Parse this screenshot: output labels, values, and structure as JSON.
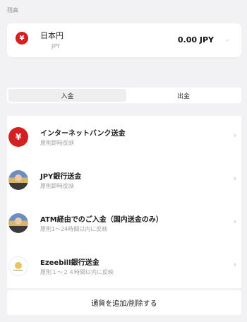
{
  "balance": {
    "caption": "残高",
    "currency_name": "日本円",
    "currency_code": "JPY",
    "amount": "0.00 JPY",
    "yen_symbol": "¥"
  },
  "tabs": {
    "deposit": "入金",
    "withdraw": "出金",
    "selected": "deposit"
  },
  "methods": [
    {
      "title": "インターネットバンク送金",
      "subtitle": "原則即時反映",
      "icon": "yen-icon"
    },
    {
      "title": "JPY銀行送金",
      "subtitle": "原則即時反映",
      "icon": "bank-avatar-icon"
    },
    {
      "title": "ATM経由でのご入金（国内送金のみ）",
      "subtitle": "原則1〜24時間以内に反映",
      "icon": "atm-avatar-icon"
    },
    {
      "title": "Ezeebill銀行送金",
      "subtitle": "原則１〜２４時間以内に反映",
      "icon": "ezeebill-logo-icon"
    }
  ],
  "footer": {
    "add_remove_label": "通貨を追加/削除する"
  },
  "colors": {
    "accent_red": "#d32020",
    "background": "#f2f2f4",
    "card": "#ffffff"
  }
}
